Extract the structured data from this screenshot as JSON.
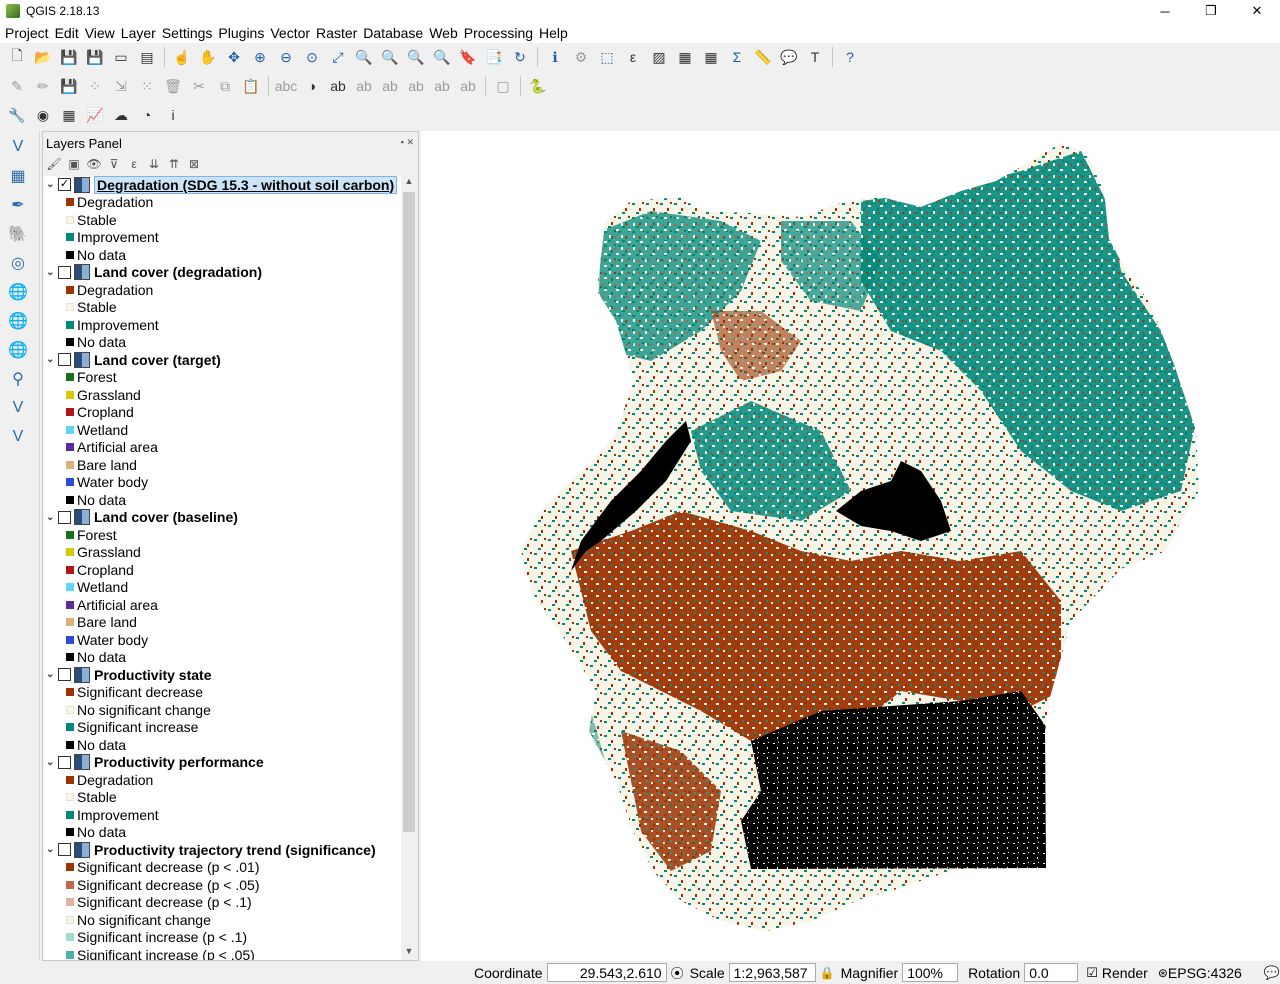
{
  "window": {
    "title": "QGIS 2.18.13",
    "minimize": "─",
    "maximize": "❐",
    "close": "✕"
  },
  "menu": [
    "Project",
    "Edit",
    "View",
    "Layer",
    "Settings",
    "Plugins",
    "Vector",
    "Raster",
    "Database",
    "Web",
    "Processing",
    "Help"
  ],
  "layers_panel": {
    "title": "Layers Panel",
    "layers": [
      {
        "name": "Degradation (SDG 15.3 - without soil carbon)",
        "checked": true,
        "selected": true,
        "items": [
          {
            "label": "Degradation",
            "color": "#9c3303"
          },
          {
            "label": "Stable",
            "color": "#f7f5e8"
          },
          {
            "label": "Improvement",
            "color": "#00897b"
          },
          {
            "label": "No data",
            "color": "#000000"
          }
        ]
      },
      {
        "name": "Land cover (degradation)",
        "checked": false,
        "selected": false,
        "items": [
          {
            "label": "Degradation",
            "color": "#9c3303"
          },
          {
            "label": "Stable",
            "color": "#f7f5e8"
          },
          {
            "label": "Improvement",
            "color": "#00897b"
          },
          {
            "label": "No data",
            "color": "#000000"
          }
        ]
      },
      {
        "name": "Land cover (target)",
        "checked": false,
        "selected": false,
        "items": [
          {
            "label": "Forest",
            "color": "#1a6e1a"
          },
          {
            "label": "Grassland",
            "color": "#d8c800"
          },
          {
            "label": "Cropland",
            "color": "#b01717"
          },
          {
            "label": "Wetland",
            "color": "#62d7f5"
          },
          {
            "label": "Artificial area",
            "color": "#5a2a96"
          },
          {
            "label": "Bare land",
            "color": "#d9b07a"
          },
          {
            "label": "Water body",
            "color": "#2e4ad6"
          },
          {
            "label": "No data",
            "color": "#000000"
          }
        ]
      },
      {
        "name": "Land cover (baseline)",
        "checked": false,
        "selected": false,
        "items": [
          {
            "label": "Forest",
            "color": "#1a6e1a"
          },
          {
            "label": "Grassland",
            "color": "#d8c800"
          },
          {
            "label": "Cropland",
            "color": "#b01717"
          },
          {
            "label": "Wetland",
            "color": "#62d7f5"
          },
          {
            "label": "Artificial area",
            "color": "#5a2a96"
          },
          {
            "label": "Bare land",
            "color": "#d9b07a"
          },
          {
            "label": "Water body",
            "color": "#2e4ad6"
          },
          {
            "label": "No data",
            "color": "#000000"
          }
        ]
      },
      {
        "name": "Productivity state",
        "checked": false,
        "selected": false,
        "items": [
          {
            "label": "Significant decrease",
            "color": "#9c3303"
          },
          {
            "label": "No significant change",
            "color": "#f7f5e8"
          },
          {
            "label": "Significant increase",
            "color": "#00897b"
          },
          {
            "label": "No data",
            "color": "#000000"
          }
        ]
      },
      {
        "name": "Productivity performance",
        "checked": false,
        "selected": false,
        "items": [
          {
            "label": "Degradation",
            "color": "#9c3303"
          },
          {
            "label": "Stable",
            "color": "#f7f5e8"
          },
          {
            "label": "Improvement",
            "color": "#00897b"
          },
          {
            "label": "No data",
            "color": "#000000"
          }
        ]
      },
      {
        "name": "Productivity trajectory trend (significance)",
        "checked": false,
        "selected": false,
        "items": [
          {
            "label": "Significant decrease (p < .01)",
            "color": "#9c3303"
          },
          {
            "label": "Significant decrease (p < .05)",
            "color": "#c0684a"
          },
          {
            "label": "Significant decrease (p < .1)",
            "color": "#e0b2a2"
          },
          {
            "label": "No significant change",
            "color": "#f7f5e8"
          },
          {
            "label": "Significant increase (p < .1)",
            "color": "#9fd9d0"
          },
          {
            "label": "Significant increase (p < .05)",
            "color": "#4db3a6"
          }
        ]
      }
    ]
  },
  "map_colors": {
    "degradation": "#9c3303",
    "stable": "#f7f5e8",
    "improvement": "#00897b",
    "nodata": "#000000"
  },
  "statusbar": {
    "coordinate_label": "Coordinate",
    "coordinate_value": "29.543,2.610",
    "scale_label": "Scale",
    "scale_value": "1:2,963,587",
    "magnifier_label": "Magnifier",
    "magnifier_value": "100%",
    "rotation_label": "Rotation",
    "rotation_value": "0.0",
    "render_label": "Render",
    "crs": "EPSG:4326"
  }
}
